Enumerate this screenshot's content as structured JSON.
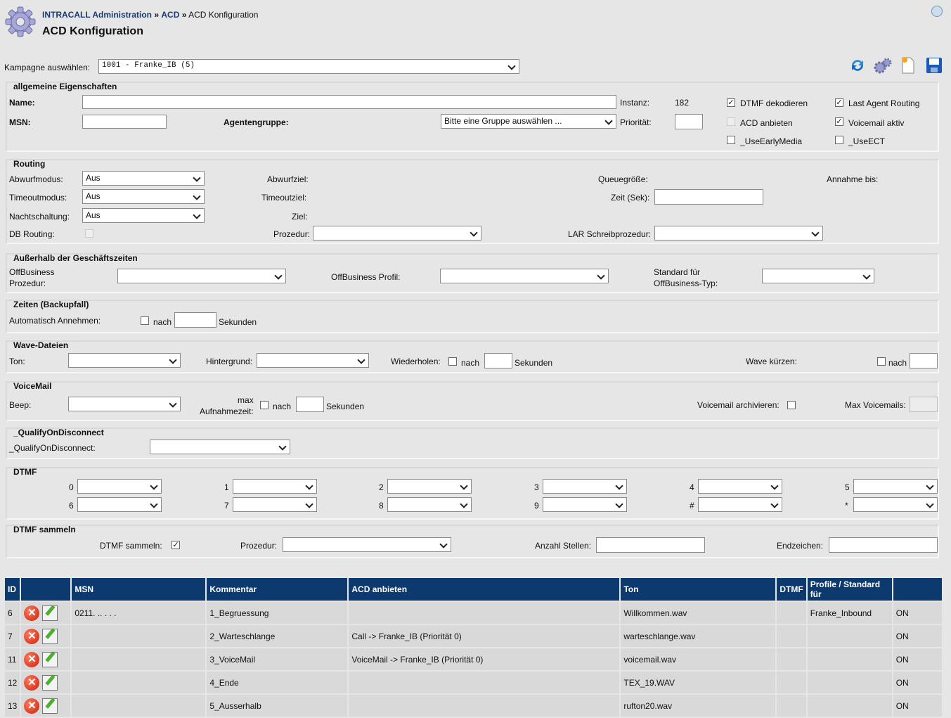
{
  "header": {
    "breadcrumb": [
      "INTRACALL Administration",
      "ACD",
      "ACD Konfiguration"
    ],
    "sep": "»",
    "title": "ACD Konfiguration"
  },
  "campaign": {
    "label": "Kampagne auswählen:",
    "value": "1001  - Franke_IB (5)"
  },
  "toolbar": {
    "icons": [
      "refresh-icon",
      "settings-icon",
      "new-document-icon",
      "save-icon"
    ]
  },
  "general": {
    "legend": "allgemeine Eigenschaften",
    "name_label": "Name:",
    "name_value": "",
    "instanz_label": "Instanz:",
    "instanz_value": "182",
    "msn_label": "MSN:",
    "msn_value": "",
    "agentgroup_label": "Agentengruppe:",
    "agentgroup_value": "Bitte eine Gruppe auswählen ...",
    "prio_label": "Priorität:",
    "prio_value": "",
    "checks": [
      {
        "label": "DTMF dekodieren",
        "checked": true
      },
      {
        "label": "Last Agent Routing",
        "checked": true
      },
      {
        "label": "ACD anbieten",
        "checked": false,
        "disabled": true
      },
      {
        "label": "Voicemail aktiv",
        "checked": true
      },
      {
        "label": "_UseEarlyMedia",
        "checked": false
      },
      {
        "label": "_UseECT",
        "checked": false
      }
    ]
  },
  "routing": {
    "legend": "Routing",
    "abwurfmodus": "Abwurfmodus:",
    "abwurfmodus_value": "Aus",
    "abwurfziel": "Abwurfziel:",
    "queue": "Queuegröße:",
    "annahme": "Annahme bis:",
    "timeoutmodus": "Timeoutmodus:",
    "timeoutmodus_value": "Aus",
    "timeoutziel": "Timeoutziel:",
    "zeit": "Zeit (Sek):",
    "nacht": "Nachtschaltung:",
    "nacht_value": "Aus",
    "ziel": "Ziel:",
    "db": "DB Routing:",
    "prozedur": "Prozedur:",
    "lar": "LAR Schreibprozedur:"
  },
  "offbusiness": {
    "legend": "Außerhalb der Geschäftszeiten",
    "prozedur": [
      "OffBusiness",
      "Prozedur:"
    ],
    "profil": "OffBusiness Profil:",
    "standard": [
      "Standard für",
      "OffBusiness-Typ:"
    ]
  },
  "zeiten": {
    "legend": "Zeiten (Backupfall)",
    "auto": "Automatisch Annehmen:",
    "nach": "nach",
    "sek": "Sekunden"
  },
  "wave": {
    "legend": "Wave-Dateien",
    "ton": "Ton:",
    "hintergrund": "Hintergrund:",
    "wiederholen": "Wiederholen:",
    "nach": "nach",
    "sek": "Sekunden",
    "kuerzen": "Wave kürzen:"
  },
  "voicemail": {
    "legend": "VoiceMail",
    "beep": "Beep:",
    "max": [
      "max",
      "Aufnahmezeit:"
    ],
    "nach": "nach",
    "sek": "Sekunden",
    "archiv": "Voicemail archivieren:",
    "maxvm": "Max Voicemails:"
  },
  "qualify": {
    "legend": "_QualifyOnDisconnect",
    "label": "_QualifyOnDisconnect:"
  },
  "dtmf": {
    "legend": "DTMF",
    "keys": [
      "0",
      "1",
      "2",
      "3",
      "4",
      "5",
      "6",
      "7",
      "8",
      "9",
      "#",
      "*"
    ]
  },
  "dtmfs": {
    "legend": "DTMF sammeln",
    "sammeln": "DTMF sammeln:",
    "sammeln_checked": true,
    "prozedur": "Prozedur:",
    "anzahl": "Anzahl Stellen:",
    "end": "Endzeichen:"
  },
  "table": {
    "headers": [
      "ID",
      "",
      "MSN",
      "Kommentar",
      "ACD anbieten",
      "Ton",
      "DTMF",
      "Profile / Standard für",
      ""
    ],
    "rows": [
      [
        "6",
        "",
        "0211. .. . . .",
        "1_Begruessung",
        "",
        "Willkommen.wav",
        "",
        "Franke_Inbound",
        "ON"
      ],
      [
        "7",
        "",
        "",
        "2_Warteschlange",
        "Call -> Franke_IB (Priorität 0)",
        "warteschlange.wav",
        "",
        "",
        "ON"
      ],
      [
        "11",
        "",
        "",
        "3_VoiceMail",
        "VoiceMail -> Franke_IB (Priorität 0)",
        "voicemail.wav",
        "",
        "",
        "ON"
      ],
      [
        "12",
        "",
        "",
        "4_Ende",
        "",
        "TEX_19.WAV",
        "",
        "",
        "ON"
      ],
      [
        "13",
        "",
        "",
        "5_Ausserhalb",
        "",
        "rufton20.wav",
        "",
        "",
        "ON"
      ]
    ]
  },
  "colors": {
    "header_bg": "#0d3a6e",
    "link": "#1a3b6e"
  }
}
